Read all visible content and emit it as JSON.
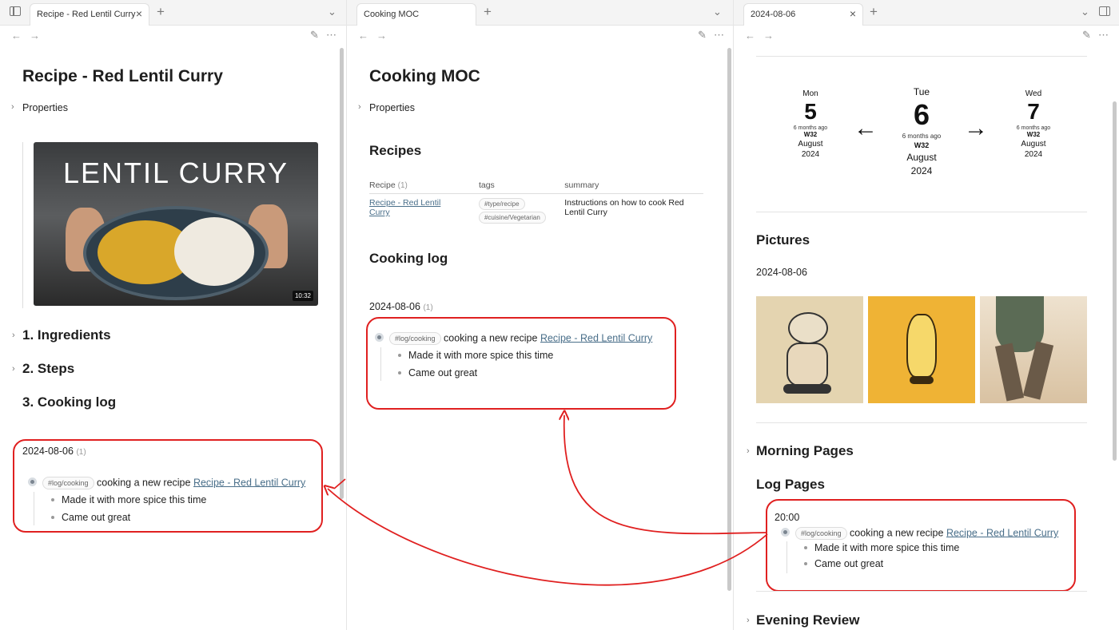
{
  "left": {
    "tab_title": "Recipe - Red Lentil Curry",
    "page_title": "Recipe - Red Lentil Curry",
    "properties_label": "Properties",
    "video": {
      "title_text": "LENTIL CURRY",
      "duration": "10:32"
    },
    "headings": [
      "1. Ingredients",
      "2. Steps",
      "3. Cooking log"
    ],
    "log": {
      "date": "2024-08-06",
      "count": "(1)",
      "tag": "#log/cooking",
      "text": "cooking a new recipe",
      "link": "Recipe - Red Lentil Curry",
      "sub_items": [
        "Made it with more spice this time",
        "Came out great"
      ]
    }
  },
  "middle": {
    "tab_title": "Cooking MOC",
    "page_title": "Cooking MOC",
    "properties_label": "Properties",
    "recipes_heading": "Recipes",
    "table": {
      "headers": [
        "Recipe",
        "tags",
        "summary"
      ],
      "header_count": "(1)",
      "row": {
        "recipe": "Recipe - Red Lentil Curry",
        "tags": [
          "#type/recipe",
          "#cuisine/Vegetarian"
        ],
        "summary": "Instructions on how to cook Red Lentil Curry"
      }
    },
    "cooking_log_heading": "Cooking log",
    "log": {
      "date": "2024-08-06",
      "count": "(1)",
      "tag": "#log/cooking",
      "text": "cooking a new recipe",
      "link": "Recipe - Red Lentil Curry",
      "sub_items": [
        "Made it with more spice this time",
        "Came out great"
      ]
    }
  },
  "right": {
    "tab_title": "2024-08-06",
    "days": [
      {
        "name": "Mon",
        "num": "5",
        "ago": "6 months ago",
        "week": "W32",
        "month": "August",
        "year": "2024"
      },
      {
        "name": "Tue",
        "num": "6",
        "ago": "6 months ago",
        "week": "W32",
        "month": "August",
        "year": "2024"
      },
      {
        "name": "Wed",
        "num": "7",
        "ago": "6 months ago",
        "week": "W32",
        "month": "August",
        "year": "2024"
      }
    ],
    "arrows": {
      "prev": "←",
      "next": "→"
    },
    "pictures_heading": "Pictures",
    "pictures_date": "2024-08-06",
    "morning_pages": "Morning Pages",
    "log_pages": "Log Pages",
    "log": {
      "time": "20:00",
      "tag": "#log/cooking",
      "text": "cooking a new recipe",
      "link": "Recipe - Red Lentil Curry",
      "sub_items": [
        "Made it with more spice this time",
        "Came out great"
      ]
    },
    "evening_review": "Evening Review"
  },
  "icons": {
    "sidebar": "sidebar-toggle-icon",
    "back": "arrow-left-icon",
    "forward": "arrow-right-icon",
    "edit": "pencil-icon",
    "more": "more-horizontal-icon"
  },
  "colors": {
    "annotation": "#e02020",
    "link": "#4a6f8a"
  }
}
